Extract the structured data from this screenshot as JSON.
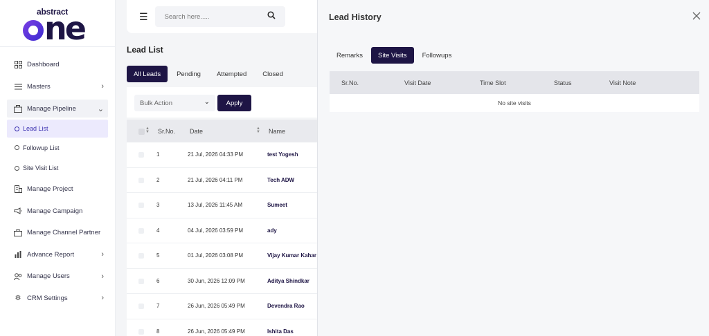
{
  "logo": {
    "small": "abstract",
    "big": "one"
  },
  "sidebar": {
    "items": [
      {
        "label": "Dashboard",
        "icon": "dashboard-icon"
      },
      {
        "label": "Masters",
        "icon": "list-icon",
        "chevron": "›"
      },
      {
        "label": "Manage Pipeline",
        "icon": "pipeline-icon",
        "chevron": "⌄"
      },
      {
        "label": "Manage Project",
        "icon": "building-icon"
      },
      {
        "label": "Manage Campaign",
        "icon": "megaphone-icon"
      },
      {
        "label": "Manage Channel Partner",
        "icon": "partner-icon"
      },
      {
        "label": "Advance Report",
        "icon": "bar-chart-icon",
        "chevron": "›"
      },
      {
        "label": "Manage Users",
        "icon": "users-icon",
        "chevron": "›"
      },
      {
        "label": "CRM Settings",
        "icon": "gear-icon",
        "chevron": "›"
      }
    ],
    "sub_items": [
      {
        "label": "Lead List"
      },
      {
        "label": "Followup List"
      },
      {
        "label": "Site Visit List"
      }
    ]
  },
  "search": {
    "placeholder": "Search here....."
  },
  "lead_list": {
    "title": "Lead List",
    "tabs": [
      "All Leads",
      "Pending",
      "Attempted",
      "Closed"
    ],
    "bulk_action": "Bulk Action",
    "apply": "Apply",
    "columns": [
      "Sr.No.",
      "Date",
      "Name"
    ],
    "rows": [
      {
        "sr": "1",
        "date": "21 Jul, 2026 04:33 PM",
        "name": "test Yogesh"
      },
      {
        "sr": "2",
        "date": "21 Jul, 2026 04:11 PM",
        "name": "Tech ADW"
      },
      {
        "sr": "3",
        "date": "13 Jul, 2026 11:45 AM",
        "name": "Sumeet"
      },
      {
        "sr": "4",
        "date": "04 Jul, 2026 03:59 PM",
        "name": "ady"
      },
      {
        "sr": "5",
        "date": "01 Jul, 2026 03:08 PM",
        "name": "Vijay Kumar Kahar"
      },
      {
        "sr": "6",
        "date": "30 Jun, 2026 12:09 PM",
        "name": "Aditya Shindkar"
      },
      {
        "sr": "7",
        "date": "26 Jun, 2026 05:49 PM",
        "name": "Devendra Rao"
      },
      {
        "sr": "8",
        "date": "26 Jun, 2026 05:49 PM",
        "name": "Ishita Das"
      }
    ]
  },
  "drawer": {
    "title": "Lead History",
    "tabs": [
      "Remarks",
      "Site Visits",
      "Followups"
    ],
    "columns": [
      "Sr.No.",
      "Visit Date",
      "Time Slot",
      "Status",
      "Visit Note"
    ],
    "empty": "No site visits"
  },
  "colors": {
    "primary": "#1e1545",
    "accent": "#3a2fb0"
  }
}
